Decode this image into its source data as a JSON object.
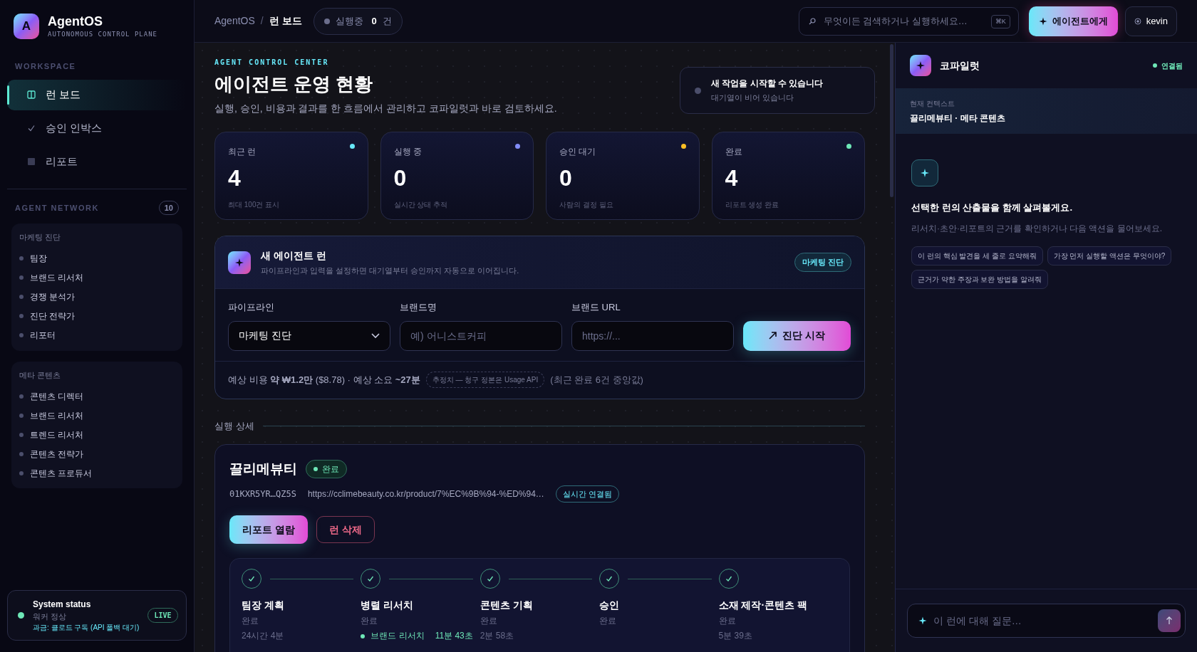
{
  "sidebar": {
    "logo_letter": "A",
    "app_name": "AgentOS",
    "tagline": "AUTONOMOUS CONTROL PLANE",
    "workspace_heading": "WORKSPACE",
    "nav": [
      {
        "label": "런 보드",
        "selected": true
      },
      {
        "label": "승인 인박스",
        "selected": false
      },
      {
        "label": "리포트",
        "selected": false
      }
    ],
    "network_heading": "AGENT NETWORK",
    "network_count": "10",
    "groups": [
      {
        "title": "마케팅 진단",
        "agents": [
          "팀장",
          "브랜드 리서처",
          "경쟁 분석가",
          "진단 전략가",
          "리포터"
        ]
      },
      {
        "title": "메타 콘텐츠",
        "agents": [
          "콘텐츠 디렉터",
          "브랜드 리서처",
          "트렌드 리서처",
          "콘텐츠 전략가",
          "콘텐츠 프로듀서"
        ]
      }
    ],
    "system_status": {
      "title": "System status",
      "worker": "워커 정상",
      "billing": "과금: 클로드 구독 (API 폴백 대기)",
      "badge": "LIVE"
    }
  },
  "topbar": {
    "breadcrumb": [
      "AgentOS",
      "런 보드"
    ],
    "breadcrumb_separator": "/",
    "running_label": "실행중",
    "running_count": "0",
    "running_unit": "건",
    "search_placeholder": "무엇이든 검색하거나 실행하세요…",
    "search_shortcut": "⌘K",
    "agent_button": "에이전트에게",
    "user": "kevin"
  },
  "header": {
    "eyebrow": "AGENT CONTROL CENTER",
    "title": "에이전트 운영 현황",
    "subtitle": "실행, 승인, 비용과 결과를 한 흐름에서 관리하고 코파일럿과 바로 검토하세요.",
    "queue_title": "새 작업을 시작할 수 있습니다",
    "queue_detail": "대기열이 비어 있습니다"
  },
  "stats": [
    {
      "label": "최근 런",
      "value": "4",
      "caption": "최대 100건 표시",
      "color": "#67e8f9"
    },
    {
      "label": "실행 중",
      "value": "0",
      "caption": "실시간 상태 추적",
      "color": "#818cf8"
    },
    {
      "label": "승인 대기",
      "value": "0",
      "caption": "사람의 결정 필요",
      "color": "#fbbf24"
    },
    {
      "label": "완료",
      "value": "4",
      "caption": "리포트 생성 완료",
      "color": "#6ee7b7"
    }
  ],
  "new_run": {
    "title": "새 에이전트 런",
    "subtitle": "파이프라인과 입력을 설정하면 대기열부터 승인까지 자동으로 이어집니다.",
    "badge": "마케팅 진단",
    "fields": [
      {
        "kind": "select",
        "label": "파이프라인",
        "value": "마케팅 진단"
      },
      {
        "kind": "text",
        "label": "브랜드명",
        "placeholder": "예) 어니스트커피"
      },
      {
        "kind": "text",
        "label": "브랜드 URL",
        "placeholder": "https://..."
      }
    ],
    "start_button": "진단 시작",
    "estimate": "예상 비용 **약 ₩1.2만** ($8.78) · 예상 소요 **~27분**",
    "estimate_tag": "추정치 — 청구 정본은 Usage API",
    "estimate_note": "(최근 완료 6건 중앙값)"
  },
  "run_detail": {
    "section_title": "실행 상세",
    "brand": "끌리메뷰티",
    "status": "완료",
    "run_id": "01KXR5YR…QZ5S",
    "url": "https://cclimebeauty.co.kr/product/7%EC%9B%94-%ED%94…",
    "live_badge": "실시간 연결됨",
    "open_report": "리포트 열람",
    "delete": "런 삭제",
    "steps": [
      {
        "title": "팀장 계획",
        "status": "완료",
        "duration": "24시간 4분",
        "done": true
      },
      {
        "title": "병렬 리서치",
        "status": "완료",
        "done": true,
        "sub": [
          {
            "name": "브랜드 리서치",
            "duration": "11분 43초"
          }
        ]
      },
      {
        "title": "콘텐츠 기획",
        "status": "완료",
        "duration": "2분 58초",
        "done": true
      },
      {
        "title": "승인",
        "status": "완료",
        "done": true
      },
      {
        "title": "소재 제작·콘텐츠 팩",
        "status": "완료",
        "duration": "5분 39초",
        "done": true
      }
    ]
  },
  "copilot": {
    "title": "코파일럿",
    "connection": "연결됨",
    "context_label": "현재 컨텍스트",
    "context_value": "끌리메뷰티 · 메타 콘텐츠",
    "intro_title": "선택한 런의 산출물을 함께 살펴볼게요.",
    "intro_text": "리서치·초안·리포트의 근거를 확인하거나 다음 액션을 물어보세요.",
    "suggestions": [
      "이 런의 핵심 발견을 세 줄로 요약해줘",
      "가장 먼저 실행할 액션은 무엇이야?",
      "근거가 약한 주장과 보완 방법을 알려줘"
    ],
    "input_placeholder": "이 런에 대해 질문…"
  }
}
